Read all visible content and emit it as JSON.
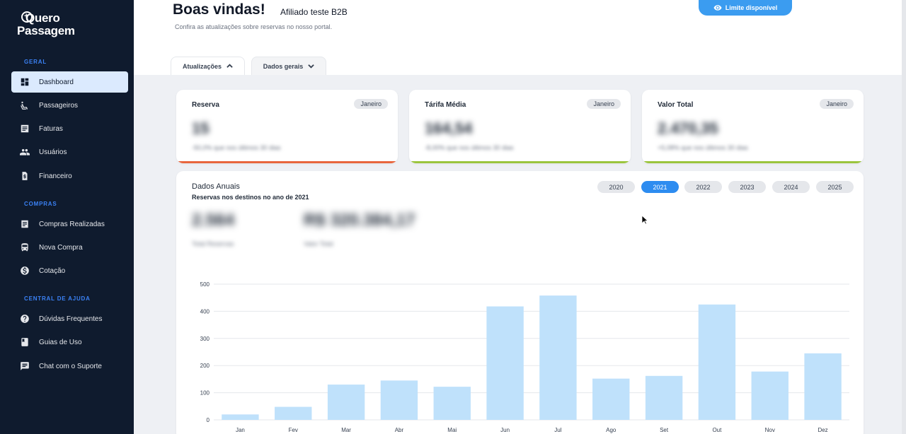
{
  "brand": {
    "line1": "Quero",
    "line2": "Passagem"
  },
  "sidebar": {
    "sections": [
      {
        "label": "GERAL"
      },
      {
        "label": "COMPRAS"
      },
      {
        "label": "CENTRAL DE AJUDA"
      }
    ],
    "items": [
      {
        "label": "Dashboard",
        "icon": "dashboard-icon",
        "active": true
      },
      {
        "label": "Passageiros",
        "icon": "seat-icon"
      },
      {
        "label": "Faturas",
        "icon": "invoice-icon"
      },
      {
        "label": "Usuários",
        "icon": "users-icon"
      },
      {
        "label": "Financeiro",
        "icon": "money-file-icon"
      },
      {
        "label": "Compras Realizadas",
        "icon": "receipt-icon"
      },
      {
        "label": "Nova Compra",
        "icon": "bus-icon"
      },
      {
        "label": "Cotação",
        "icon": "dollar-icon"
      },
      {
        "label": "Dúvidas Frequentes",
        "icon": "help-icon"
      },
      {
        "label": "Guias de Uso",
        "icon": "book-icon"
      },
      {
        "label": "Chat com o Suporte",
        "icon": "chat-icon"
      }
    ]
  },
  "header": {
    "welcome": "Boas vindas!",
    "subtitle": "Afiliado teste B2B",
    "info": "Confira as atualizações sobre reservas no nosso portal.",
    "limit_button": "Limite disponível"
  },
  "tabs": [
    {
      "label": "Atualizações",
      "active": true
    },
    {
      "label": "Dados gerais",
      "active": false
    }
  ],
  "kpis": [
    {
      "title": "Reserva",
      "month": "Janeiro",
      "value": "15",
      "note": "-50,0% que nos últimos 30 dias",
      "bar_color": "#e8663d"
    },
    {
      "title": "Tárifa Média",
      "month": "Janeiro",
      "value": "164,54",
      "note": "-8,00% que nos últimos 30 dias",
      "bar_color": "#9bc53d"
    },
    {
      "title": "Valor Total",
      "month": "Janeiro",
      "value": "2.470,35",
      "note": "+5,08% que nos últimos 30 dias",
      "bar_color": "#9bc53d"
    }
  ],
  "annual": {
    "title": "Dados Anuais",
    "subtitle": "Reservas nos destinos no ano de 2021",
    "years": [
      "2020",
      "2021",
      "2022",
      "2023",
      "2024",
      "2025"
    ],
    "selected_year": "2021",
    "total_reservas": "2.564",
    "total_reservas_label": "Total Reservas",
    "total_valor": "R$ 320.384,17",
    "total_valor_label": "Valor Total"
  },
  "chart_data": {
    "type": "bar",
    "categories": [
      "Jan",
      "Fev",
      "Mar",
      "Abr",
      "Mai",
      "Jun",
      "Jul",
      "Ago",
      "Set",
      "Out",
      "Nov",
      "Dez"
    ],
    "values": [
      20,
      48,
      130,
      145,
      122,
      418,
      458,
      152,
      162,
      425,
      178,
      245
    ],
    "yticks": [
      0,
      100,
      200,
      300,
      400,
      500
    ],
    "ylim": [
      0,
      500
    ],
    "grid": true,
    "bar_color": "#bfe1fb"
  }
}
